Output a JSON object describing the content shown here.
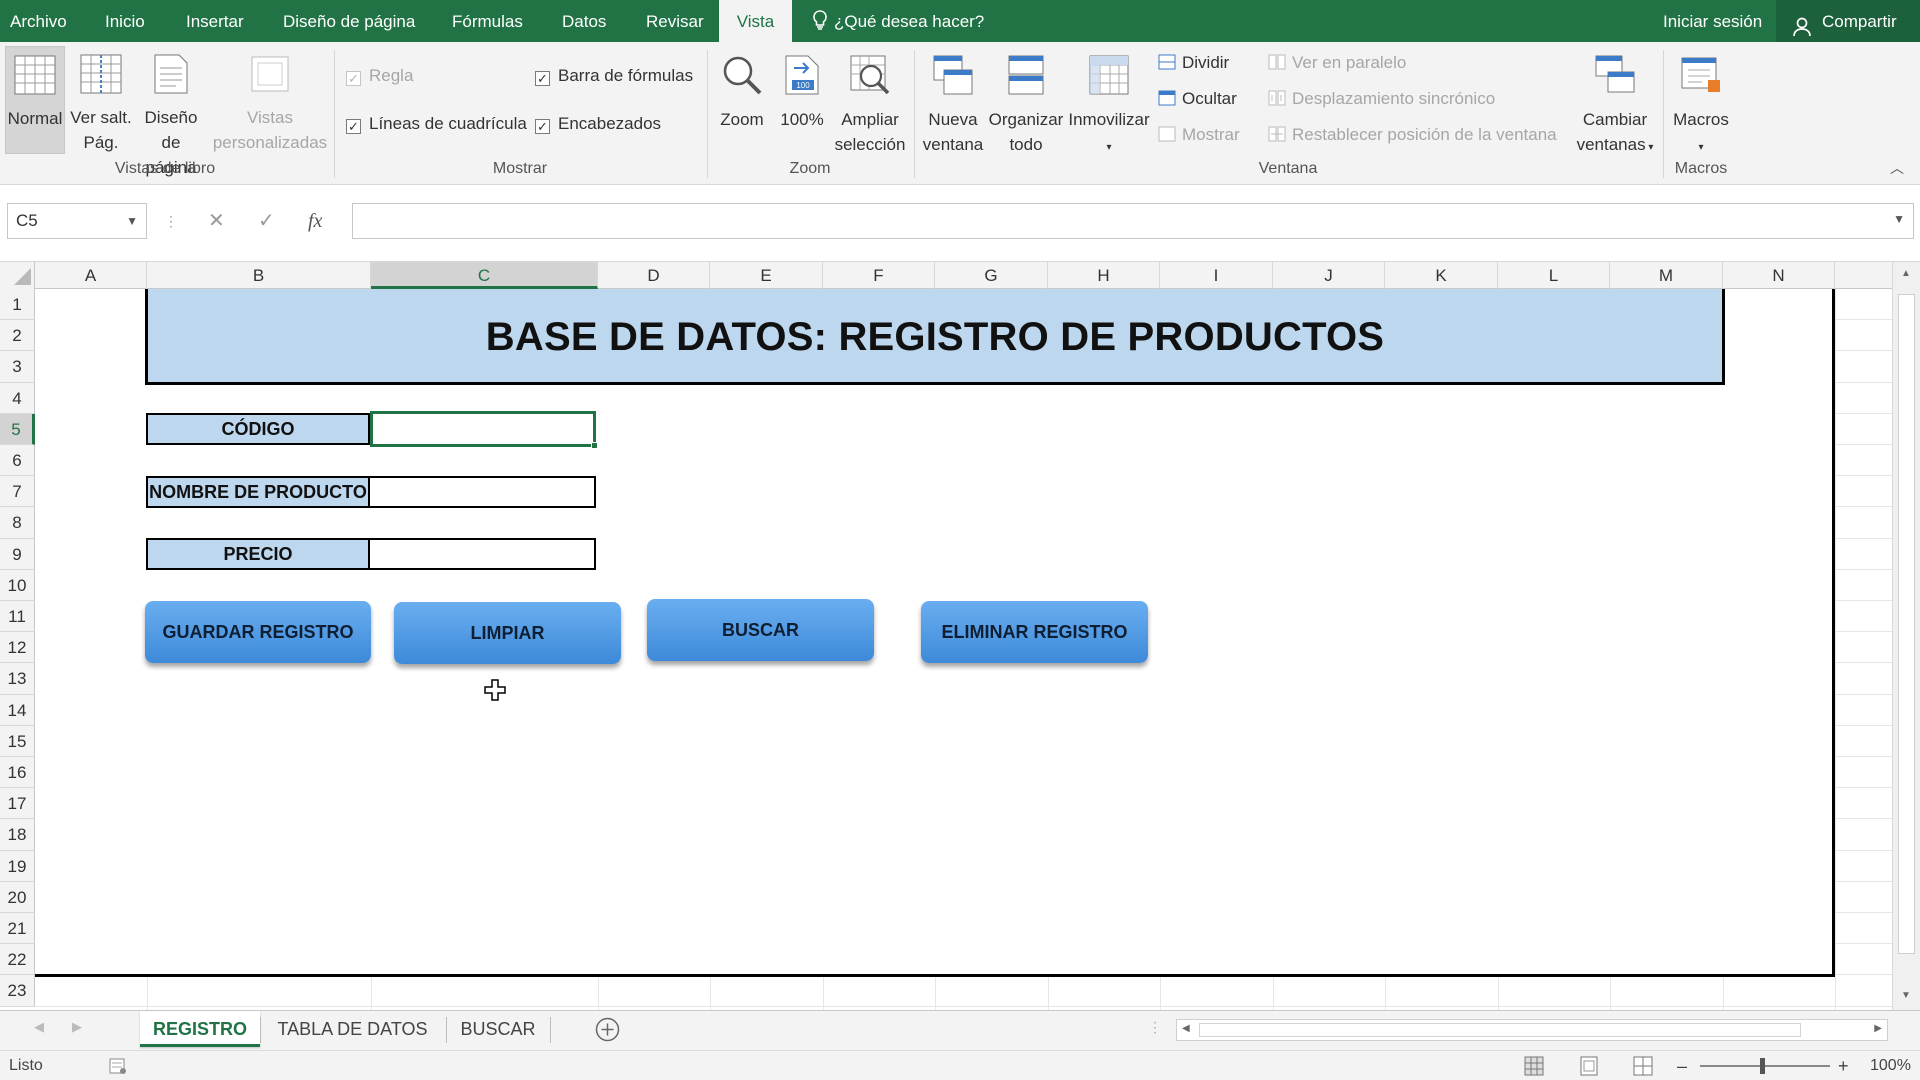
{
  "menubar": {
    "tabs": [
      "Archivo",
      "Inicio",
      "Insertar",
      "Diseño de página",
      "Fórmulas",
      "Datos",
      "Revisar",
      "Vista"
    ],
    "active_tab": "Vista",
    "tell_me": "¿Qué desea hacer?",
    "sign_in": "Iniciar sesión",
    "share": "Compartir",
    "accent_color": "#217346"
  },
  "ribbon": {
    "vistas_libro": {
      "label": "Vistas de libro",
      "normal": "Normal",
      "salto_1": "Ver salt.",
      "salto_2": "Pág.",
      "diseno_1": "Diseño",
      "diseno_2": "de página",
      "vistas_1": "Vistas",
      "vistas_2": "personalizadas"
    },
    "mostrar": {
      "label": "Mostrar",
      "regla": "Regla",
      "barra_formulas": "Barra de fórmulas",
      "lineas": "Líneas de cuadrícula",
      "encabezados": "Encabezados"
    },
    "zoom": {
      "label": "Zoom",
      "zoom": "Zoom",
      "cien": "100%",
      "ampliar_1": "Ampliar",
      "ampliar_2": "selección"
    },
    "ventana": {
      "label": "Ventana",
      "nueva_1": "Nueva",
      "nueva_2": "ventana",
      "organizar_1": "Organizar",
      "organizar_2": "todo",
      "inmovilizar": "Inmovilizar",
      "dividir": "Dividir",
      "ocultar": "Ocultar",
      "mostrar": "Mostrar",
      "paralelo": "Ver en paralelo",
      "desplazamiento": "Desplazamiento sincrónico",
      "restablecer": "Restablecer posición de la ventana",
      "cambiar_1": "Cambiar",
      "cambiar_2": "ventanas"
    },
    "macros": {
      "label": "Macros",
      "macros": "Macros"
    }
  },
  "formula_bar": {
    "name_box": "C5",
    "fx": "fx",
    "value": ""
  },
  "grid": {
    "columns": [
      "A",
      "B",
      "C",
      "D",
      "E",
      "F",
      "G",
      "H",
      "I",
      "J",
      "K",
      "L",
      "M",
      "N"
    ],
    "rows": [
      "1",
      "2",
      "3",
      "4",
      "5",
      "6",
      "7",
      "8",
      "9",
      "10",
      "11",
      "12",
      "13",
      "14",
      "15",
      "16",
      "17",
      "18",
      "19",
      "20",
      "21",
      "22",
      "23"
    ],
    "selected_column": "C",
    "selected_row": "5"
  },
  "form": {
    "title": "BASE DE DATOS: REGISTRO DE PRODUCTOS",
    "codigo_label": "CÓDIGO",
    "nombre_label": "NOMBRE DE PRODUCTO",
    "precio_label": "PRECIO",
    "codigo_value": "",
    "nombre_value": "",
    "precio_value": "",
    "label_color": "#bdd7ee",
    "button_color": "#4a95e0"
  },
  "buttons": {
    "guardar": "GUARDAR REGISTRO",
    "limpiar": "LIMPIAR",
    "buscar": "BUSCAR",
    "eliminar": "ELIMINAR REGISTRO"
  },
  "sheets": {
    "tabs": [
      "REGISTRO",
      "TABLA DE DATOS",
      "BUSCAR"
    ],
    "active": "REGISTRO"
  },
  "statusbar": {
    "status": "Listo",
    "zoom": "100%"
  }
}
